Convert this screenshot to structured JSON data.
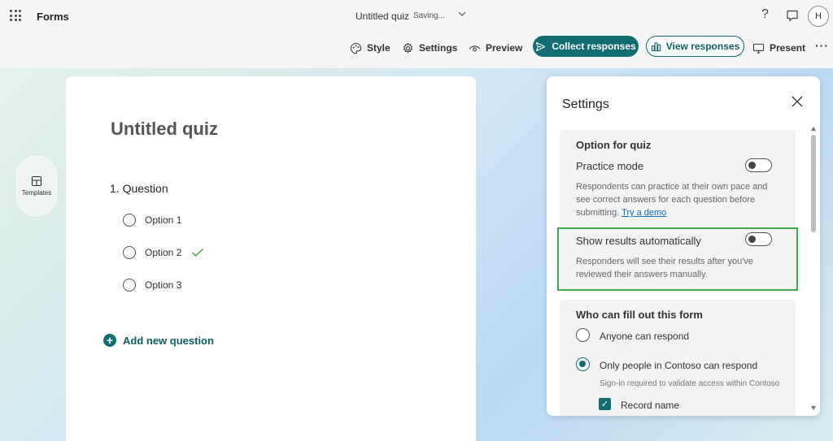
{
  "app": {
    "name": "Forms"
  },
  "header": {
    "doc_title": "Untitled quiz",
    "status": "Saving...",
    "avatar_initial": "H"
  },
  "toolbar": {
    "style": "Style",
    "settings": "Settings",
    "preview": "Preview",
    "collect": "Collect responses",
    "view": "View responses",
    "present": "Present"
  },
  "sidebar": {
    "templates": "Templates"
  },
  "form": {
    "title": "Untitled quiz",
    "question": "1. Question",
    "options": [
      "Option 1",
      "Option 2",
      "Option 3"
    ],
    "correct_option_index": 1,
    "add_question": "Add new question"
  },
  "settings": {
    "title": "Settings",
    "quiz_section": {
      "heading": "Option for quiz",
      "practice_mode": {
        "label": "Practice mode",
        "enabled": false,
        "description": "Respondents can practice at their own pace and see correct answers for each question before submitting.",
        "link": "Try a demo"
      },
      "show_results": {
        "label": "Show results automatically",
        "enabled": false,
        "description": "Responders will see their results after you've reviewed their answers manually."
      }
    },
    "fill_section": {
      "heading": "Who can fill out this form",
      "options": [
        {
          "label": "Anyone can respond",
          "selected": false
        },
        {
          "label": "Only people in Contoso can respond",
          "selected": true
        }
      ],
      "sign_in_note": "Sign-in required to validate access within Contoso",
      "record_name": {
        "label": "Record name",
        "checked": true
      }
    }
  },
  "colors": {
    "accent": "#116d72",
    "highlight": "#3db04b",
    "link": "#0f6cbd"
  }
}
